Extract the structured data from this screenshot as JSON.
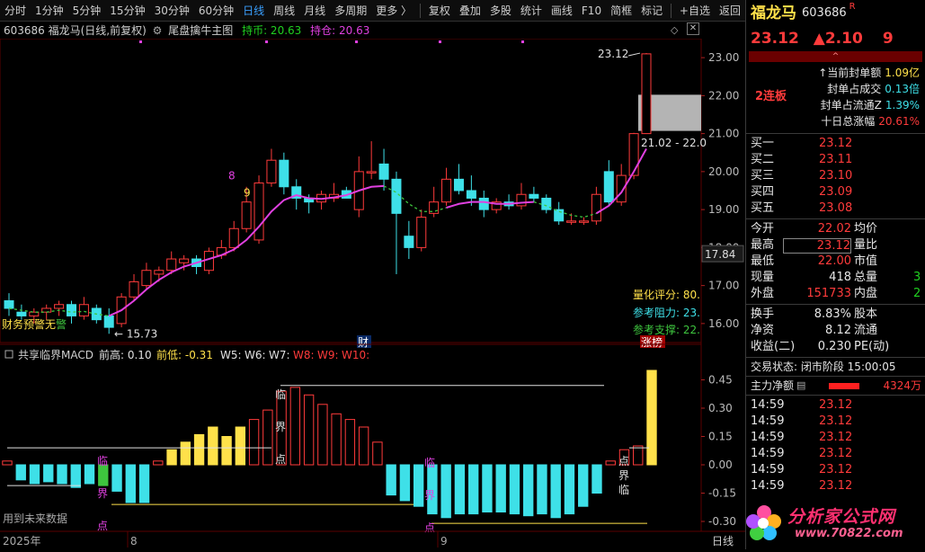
{
  "toolbar": {
    "items": [
      "分时",
      "1分钟",
      "5分钟",
      "15分钟",
      "30分钟",
      "60分钟",
      "日线",
      "周线",
      "月线",
      "多周期",
      "更多 〉",
      "复权",
      "叠加",
      "多股",
      "统计",
      "画线",
      "F10",
      "简框",
      "标记",
      "+自选",
      "返回"
    ],
    "active": "日线"
  },
  "title": {
    "stock": "603686 福龙马(日线,前复权)",
    "indicator": "尾盘擒牛主图",
    "hold_coin_label": "持币: 20.63",
    "hold_pos_label": "持仓: 20.63"
  },
  "colors": {
    "up": "#ff3b3b",
    "down": "#3ee0e8",
    "ma": "#e040e0",
    "dash": "#3ec43e",
    "yellow": "#ffe14a",
    "grid": "#5a0000"
  },
  "price_axis": {
    "ticks": [
      "23.00",
      "22.00",
      "21.00",
      "20.00",
      "19.00",
      "18.00",
      "17.00",
      "16.00"
    ],
    "current_box": "17.84"
  },
  "chart_labels": {
    "high_label": "23.12",
    "low_label": "15.73",
    "range_label": "21.02 - 22.0",
    "num8": "8",
    "num9": "9",
    "warning_prefix": "财务预警",
    "warning_mid": "无",
    "warning_suffix": "警",
    "cai": "财",
    "zhangbang": "涨榜",
    "score_label": "量化评分: 80.",
    "resist_label": "参考阻力: 23.",
    "support_label": "参考支撑: 22."
  },
  "sub_chart": {
    "title": "共享临界MACD",
    "fields": [
      "前高: 0.10",
      "前低: -0.31",
      "W5:",
      "W6:",
      "W7:",
      "W8:",
      "W9:",
      "W10:"
    ],
    "ticks": [
      "0.45",
      "0.30",
      "0.15",
      "0.00",
      "-0.15",
      "-0.30"
    ],
    "chars": [
      "临",
      "界",
      "点"
    ],
    "future_note": "用到未来数据"
  },
  "time_axis": {
    "labels": [
      "2025年",
      "8",
      "9"
    ],
    "mode": "日线"
  },
  "chart_data": {
    "type": "candlestick",
    "ohlc": [
      [
        16.6,
        16.8,
        16.2,
        16.4
      ],
      [
        16.3,
        16.5,
        16.1,
        16.2
      ],
      [
        16.2,
        16.4,
        16.0,
        16.3
      ],
      [
        16.3,
        16.5,
        16.1,
        16.4
      ],
      [
        16.4,
        16.6,
        16.2,
        16.5
      ],
      [
        16.5,
        16.6,
        16.0,
        16.2
      ],
      [
        16.2,
        16.7,
        16.1,
        16.5
      ],
      [
        16.4,
        16.5,
        16.0,
        16.1
      ],
      [
        16.2,
        16.4,
        15.73,
        15.9
      ],
      [
        16.0,
        16.8,
        15.9,
        16.7
      ],
      [
        16.7,
        17.3,
        16.6,
        17.1
      ],
      [
        17.0,
        17.6,
        16.9,
        17.4
      ],
      [
        17.3,
        17.5,
        17.1,
        17.4
      ],
      [
        17.4,
        17.9,
        17.3,
        17.7
      ],
      [
        17.6,
        17.8,
        17.4,
        17.7
      ],
      [
        17.7,
        17.8,
        17.3,
        17.5
      ],
      [
        17.4,
        18.0,
        17.3,
        17.9
      ],
      [
        17.8,
        18.2,
        17.7,
        18.0
      ],
      [
        18.0,
        18.7,
        17.9,
        18.5
      ],
      [
        18.5,
        19.6,
        18.4,
        19.2
      ],
      [
        18.2,
        19.9,
        18.1,
        19.7
      ],
      [
        19.7,
        20.6,
        19.6,
        20.3
      ],
      [
        20.3,
        20.5,
        19.4,
        19.6
      ],
      [
        19.6,
        19.8,
        19.0,
        19.3
      ],
      [
        19.3,
        19.4,
        18.9,
        19.2
      ],
      [
        19.2,
        19.5,
        19.0,
        19.4
      ],
      [
        19.3,
        19.7,
        19.2,
        19.4
      ],
      [
        19.5,
        19.6,
        19.3,
        19.3
      ],
      [
        19.0,
        20.4,
        18.8,
        20.0
      ],
      [
        20.0,
        20.8,
        19.8,
        20.0
      ],
      [
        20.2,
        20.6,
        19.5,
        19.8
      ],
      [
        19.8,
        20.0,
        17.3,
        18.9
      ],
      [
        18.3,
        18.7,
        17.7,
        18.0
      ],
      [
        18.0,
        19.0,
        17.9,
        18.8
      ],
      [
        18.9,
        19.6,
        18.8,
        19.2
      ],
      [
        19.2,
        20.1,
        19.1,
        19.8
      ],
      [
        19.8,
        20.2,
        19.4,
        19.5
      ],
      [
        19.5,
        19.9,
        19.1,
        19.3
      ],
      [
        19.3,
        19.5,
        18.8,
        19.0
      ],
      [
        19.0,
        19.3,
        18.9,
        19.2
      ],
      [
        19.2,
        19.4,
        19.0,
        19.1
      ],
      [
        19.1,
        19.7,
        19.0,
        19.4
      ],
      [
        19.4,
        19.6,
        19.2,
        19.3
      ],
      [
        19.3,
        19.4,
        18.9,
        19.0
      ],
      [
        19.0,
        19.2,
        18.6,
        18.7
      ],
      [
        18.7,
        18.9,
        18.6,
        18.7
      ],
      [
        18.7,
        18.8,
        18.6,
        18.7
      ],
      [
        18.7,
        19.6,
        18.6,
        19.4
      ],
      [
        20.0,
        20.3,
        19.1,
        19.2
      ],
      [
        19.2,
        20.2,
        19.1,
        19.9
      ],
      [
        19.9,
        21.02,
        19.8,
        21.0
      ],
      [
        21.0,
        23.12,
        21.0,
        23.1
      ]
    ],
    "ma": [
      16.4,
      16.35,
      16.3,
      16.3,
      16.35,
      16.3,
      16.32,
      16.25,
      16.2,
      16.35,
      16.6,
      16.9,
      17.15,
      17.35,
      17.5,
      17.6,
      17.7,
      17.8,
      17.95,
      18.2,
      18.55,
      18.95,
      19.25,
      19.38,
      19.3,
      19.28,
      19.32,
      19.38,
      19.5,
      19.6,
      19.62,
      19.45,
      19.15,
      18.95,
      18.95,
      19.05,
      19.15,
      19.2,
      19.2,
      19.15,
      19.15,
      19.18,
      19.2,
      19.1,
      18.95,
      18.85,
      18.8,
      18.9,
      19.1,
      19.45,
      20.0,
      20.6
    ],
    "macd": [
      0.02,
      -0.08,
      -0.1,
      -0.09,
      -0.1,
      -0.12,
      -0.1,
      -0.11,
      -0.14,
      -0.2,
      -0.2,
      0.02,
      0.08,
      0.12,
      0.16,
      0.2,
      0.15,
      0.2,
      0.24,
      0.29,
      0.39,
      0.41,
      0.37,
      0.32,
      0.27,
      0.24,
      0.2,
      0.12,
      -0.16,
      -0.19,
      -0.22,
      -0.26,
      -0.28,
      -0.26,
      -0.26,
      -0.25,
      -0.25,
      -0.26,
      -0.27,
      -0.26,
      -0.28,
      -0.26,
      -0.22,
      -0.15,
      0.02,
      0.08,
      0.1,
      0.5
    ],
    "ylim": [
      15.5,
      23.5
    ]
  },
  "quote": {
    "name": "福龙马",
    "code": "603686",
    "tag": "R",
    "price": "23.12",
    "change": "▲2.10",
    "pct": "9",
    "lianban": "2连板",
    "metrics": [
      [
        "↑当前封单额",
        "1.09亿"
      ],
      [
        "封单占成交",
        "0.13倍"
      ],
      [
        "封单占流通Z",
        "1.39%"
      ],
      [
        "十日总涨幅",
        "20.61%"
      ]
    ],
    "bids": [
      [
        "买一",
        "23.12"
      ],
      [
        "买二",
        "23.11"
      ],
      [
        "买三",
        "23.10"
      ],
      [
        "买四",
        "23.09"
      ],
      [
        "买五",
        "23.08"
      ]
    ],
    "stats": [
      [
        "今开",
        "22.02",
        "均价",
        ""
      ],
      [
        "最高",
        "23.12",
        "量比",
        ""
      ],
      [
        "最低",
        "22.00",
        "市值",
        ""
      ],
      [
        "现量",
        "418",
        "总量",
        "3"
      ],
      [
        "外盘",
        "151733",
        "内盘",
        "2"
      ]
    ],
    "stats2": [
      [
        "换手",
        "8.83%",
        "股本"
      ],
      [
        "净资",
        "8.12",
        "流通"
      ],
      [
        "收益(二)",
        "0.230",
        "PE(动)"
      ]
    ],
    "trade_state": "交易状态: 闭市阶段 15:00:05",
    "main_flow_label": "主力净额",
    "main_flow_value": "4324万",
    "ticks": [
      [
        "14:59",
        "23.12"
      ],
      [
        "14:59",
        "23.12"
      ],
      [
        "14:59",
        "23.12"
      ],
      [
        "14:59",
        "23.12"
      ],
      [
        "14:59",
        "23.12"
      ],
      [
        "14:59",
        "23.12"
      ]
    ],
    "watermark": "分析家公式网",
    "watermark_url": "www.70822.com"
  }
}
